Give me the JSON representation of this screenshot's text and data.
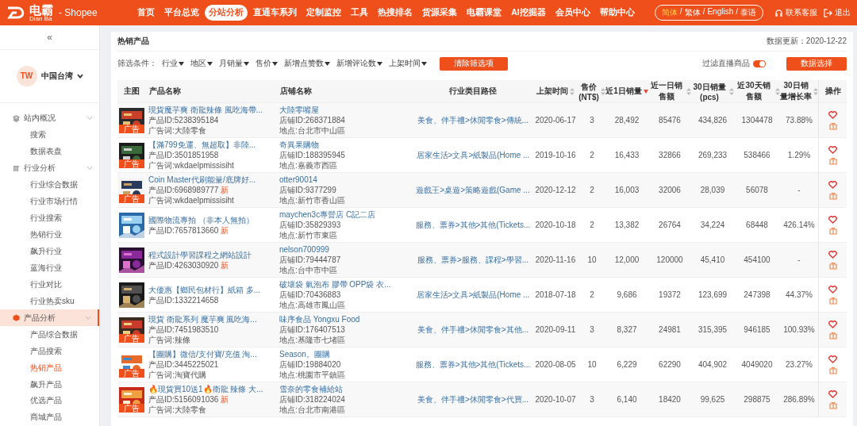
{
  "header": {
    "logo": "电霸",
    "logo_sub": "Dian Ba",
    "platform": "- Shopee",
    "nav": [
      {
        "label": "首页",
        "selected": false
      },
      {
        "label": "平台总览",
        "selected": false
      },
      {
        "label": "分站分析",
        "selected": true
      },
      {
        "label": "直通车系列",
        "selected": false
      },
      {
        "label": "定制监控",
        "selected": false
      },
      {
        "label": "工具",
        "selected": false
      },
      {
        "label": "热搜排名",
        "selected": false
      },
      {
        "label": "货源采集",
        "selected": false
      },
      {
        "label": "电霸课堂",
        "selected": false
      },
      {
        "label": "AI挖掘器",
        "selected": false
      },
      {
        "label": "会员中心",
        "selected": false
      },
      {
        "label": "帮助中心",
        "selected": false
      }
    ],
    "language_separator": "/",
    "languages": [
      {
        "label": "简体",
        "selected": true
      },
      {
        "label": "繁体",
        "selected": false
      },
      {
        "label": "English",
        "selected": false
      },
      {
        "label": "泰语",
        "selected": false
      }
    ],
    "support": "联系客服",
    "logout": "退出"
  },
  "sidebar": {
    "collapse": "«",
    "region_avatar": "TW",
    "region": "中国台湾",
    "groups": [
      {
        "label": "站内概况",
        "expanded": true,
        "selected": false,
        "children": [
          {
            "label": "搜索",
            "selected": false
          },
          {
            "label": "数据表盘",
            "selected": false
          }
        ]
      },
      {
        "label": "行业分析",
        "expanded": true,
        "selected": false,
        "children": [
          {
            "label": "行业综合数据",
            "selected": false
          },
          {
            "label": "行业市场行情",
            "selected": false
          },
          {
            "label": "行业搜索",
            "selected": false
          },
          {
            "label": "热销行业",
            "selected": false
          },
          {
            "label": "飙升行业",
            "selected": false
          },
          {
            "label": "蓝海行业",
            "selected": false
          },
          {
            "label": "行业对比",
            "selected": false
          },
          {
            "label": "行业热卖sku",
            "selected": false
          }
        ]
      },
      {
        "label": "产品分析",
        "expanded": true,
        "selected": true,
        "children": [
          {
            "label": "产品综合数据",
            "selected": false
          },
          {
            "label": "产品搜索",
            "selected": false
          },
          {
            "label": "热销产品",
            "selected": true
          },
          {
            "label": "飙升产品",
            "selected": false
          },
          {
            "label": "优选产品",
            "selected": false
          },
          {
            "label": "商城产品",
            "selected": false
          }
        ]
      }
    ]
  },
  "page": {
    "title": "热销产品",
    "updated": "数据更新：2020-12-22"
  },
  "filter": {
    "label": "筛选条件：",
    "options": [
      "行业",
      "地区",
      "月销量",
      "售价",
      "新增点赞数",
      "新增评论数",
      "上架时间"
    ],
    "clear": "清除筛选项",
    "live_toggle": {
      "label": "过滤直播商品",
      "on": true
    },
    "data_button": "数据选择"
  },
  "table": {
    "columns": [
      {
        "label": "主图",
        "sortable": false,
        "sorted_desc": false
      },
      {
        "label": "产品名称",
        "sortable": false,
        "sorted_desc": false
      },
      {
        "label": "店铺名称",
        "sortable": false,
        "sorted_desc": false
      },
      {
        "label": "行业类目路径",
        "sortable": false,
        "sorted_desc": false
      },
      {
        "label": "上架时间",
        "sortable": true,
        "sorted_desc": false
      },
      {
        "label": "售价(NT$)",
        "sortable": true,
        "sorted_desc": false
      },
      {
        "label": "近1日销量",
        "sortable": true,
        "sorted_desc": true
      },
      {
        "label": "近一日销售额",
        "sortable": true,
        "sorted_desc": false
      },
      {
        "label": "30日销量(pcs)",
        "sortable": true,
        "sorted_desc": false
      },
      {
        "label": "近30天销售额",
        "sortable": true,
        "sorted_desc": false
      },
      {
        "label": "30日销量增长率",
        "sortable": true,
        "sorted_desc": false
      },
      {
        "label": "操作",
        "sortable": false,
        "sorted_desc": false
      }
    ],
    "rows": [
      {
        "badge": "广告",
        "name": "現貨魔芋爽 衛龍辣條 風吃海帶...",
        "product_id": "产品ID:5238395184",
        "ad_word": "广告词:大陸零食",
        "shop": "大陸零嘴屋",
        "shop_id": "店铺ID:268371884",
        "location": "地点:台北市中山區",
        "category": "美食、伴手禮>休閒零食>傳統...",
        "listed": "2020-06-17",
        "price": "3",
        "sales_1d": "28,492",
        "revenue_1d": "85476",
        "sales_30d": "434,826",
        "revenue_30d": "1304478",
        "growth": "73.88%"
      },
      {
        "badge": "广告",
        "name": "【滿799免運、無超取】非陸...",
        "product_id": "产品ID:3501851958",
        "ad_word": "广告词:wkdaelpmissisiht",
        "shop": "奇異果購物",
        "shop_id": "店铺ID:188395945",
        "location": "地点:嘉義市西區",
        "category": "居家生活>文具>紙製品(Home ...",
        "listed": "2019-10-16",
        "price": "2",
        "sales_1d": "16,433",
        "revenue_1d": "32866",
        "sales_30d": "269,233",
        "revenue_30d": "538466",
        "growth": "1.29%"
      },
      {
        "badge": "广告",
        "name": "Coin Master代刷能量/底牌好...",
        "product_id": "产品ID:6968989777",
        "new_tag": "新",
        "ad_word": "广告词:wkdaelpmissisiht",
        "shop": "otter90014",
        "shop_id": "店铺ID:9377299",
        "location": "地点:新竹市香山區",
        "category": "遊戲王>桌遊>策略遊戲(Game ...",
        "listed": "2020-12-12",
        "price": "2",
        "sales_1d": "16,003",
        "revenue_1d": "32006",
        "sales_30d": "28,039",
        "revenue_30d": "56078",
        "growth": "-"
      },
      {
        "name": "國際物流專拍 （非本人無拍）",
        "product_id": "产品ID:7657813660",
        "new_tag": "新",
        "shop": "maychen3c專營店 C記二店",
        "shop_id": "店铺ID:35829393",
        "location": "地点:新竹市東區",
        "category": "服務、票券>其他>其他(Tickets...",
        "listed": "2020-10-18",
        "price": "2",
        "sales_1d": "13,382",
        "revenue_1d": "26764",
        "sales_30d": "34,224",
        "revenue_30d": "68448",
        "growth": "426.14%"
      },
      {
        "name": "程式設計學習課程之網站設計",
        "product_id": "产品ID:4263030920",
        "new_tag": "新",
        "shop": "nelson700999",
        "shop_id": "店铺ID:79444787",
        "location": "地点:台中市中區",
        "category": "服務、票券>服務、課程>學習...",
        "listed": "2020-11-16",
        "price": "10",
        "sales_1d": "12,000",
        "revenue_1d": "120000",
        "sales_30d": "45,410",
        "revenue_30d": "454100",
        "growth": "-"
      },
      {
        "name": "大優惠【鄉民包材行】紙箱 多...",
        "product_id": "产品ID:1332214658",
        "shop": "破壞袋 氣泡布 膠帶 OPP袋 衣...",
        "shop_id": "店铺ID:70436883",
        "location": "地点:高雄市鳳山區",
        "category": "居家生活>文具>紙製品(Home ...",
        "listed": "2018-07-18",
        "price": "2",
        "sales_1d": "9,686",
        "revenue_1d": "19372",
        "sales_30d": "123,699",
        "revenue_30d": "247398",
        "growth": "44.37%"
      },
      {
        "badge": "广告",
        "name": "現貨 衛龍系列 魔芋爽 風吃海...",
        "product_id": "产品ID:7451983510",
        "ad_word": "广告词:辣條",
        "shop": "味序食品 Yongxu Food",
        "shop_id": "店铺ID:176407513",
        "location": "地点:基隆市七堵區",
        "category": "美食、伴手禮>休閒零食>其他...",
        "listed": "2020-09-11",
        "price": "3",
        "sales_1d": "8,327",
        "revenue_1d": "24981",
        "sales_30d": "315,395",
        "revenue_30d": "946185",
        "growth": "100.93%"
      },
      {
        "badge": "广告",
        "name": "【團購】微信/支付寶/充值 淘...",
        "product_id": "产品ID:3445225021",
        "ad_word": "广告词:淘寶代購",
        "shop": "Season。團購",
        "shop_id": "店铺ID:19884020",
        "location": "地点:桃園市平鎮區",
        "category": "服務、票券>其他>其他(Tickets...",
        "listed": "2020-08-05",
        "price": "10",
        "sales_1d": "6,229",
        "revenue_1d": "62290",
        "sales_30d": "404,902",
        "revenue_30d": "4049020",
        "growth": "23.27%"
      },
      {
        "badge": "广告",
        "name": "🔥現貨買10送1🔥衛龍 辣條 大...",
        "product_id": "产品ID:5156091036",
        "new_tag": "新",
        "ad_word": "广告词:大陸零食",
        "shop": "雪奈的零食補給站",
        "shop_id": "店铺ID:318224024",
        "location": "地点:台北市南港區",
        "category": "美食、伴手禮>休閒零食>代買...",
        "listed": "2020-10-07",
        "price": "3",
        "sales_1d": "6,140",
        "revenue_1d": "18420",
        "sales_30d": "99,625",
        "revenue_30d": "298875",
        "growth": "286.89%"
      }
    ]
  }
}
